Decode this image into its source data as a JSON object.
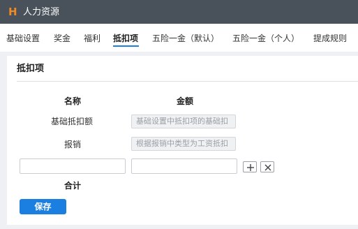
{
  "app": {
    "logo": "H",
    "title": "人力资源"
  },
  "tabs": [
    {
      "label": "基础设置",
      "active": false
    },
    {
      "label": "奖金",
      "active": false
    },
    {
      "label": "福利",
      "active": false
    },
    {
      "label": "抵扣项",
      "active": true
    },
    {
      "label": "五险一金（默认）",
      "active": false
    },
    {
      "label": "五险一金（个人）",
      "active": false
    },
    {
      "label": "提成规则",
      "active": false
    }
  ],
  "panel": {
    "title": "抵扣项",
    "columns": {
      "name": "名称",
      "amount": "金额"
    },
    "rows": [
      {
        "label": "基础抵扣额",
        "placeholder": "基础设置中抵扣项的基础扣"
      },
      {
        "label": "报销",
        "placeholder": "根据报销中类型为工资抵扣"
      }
    ],
    "new_row": {
      "name_value": "",
      "amount_value": ""
    },
    "total_label": "合计",
    "save_label": "保存"
  },
  "icons": {
    "add": "plus-icon",
    "remove": "close-icon"
  },
  "colors": {
    "topbar": "#49525a",
    "logo": "#f08a24",
    "accent": "#1a7fe0"
  }
}
